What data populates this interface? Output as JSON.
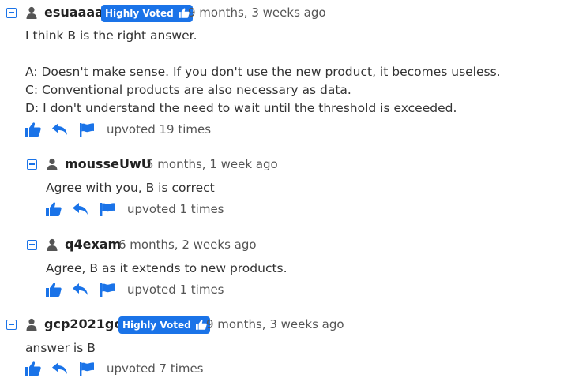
{
  "colors": {
    "accent": "#1a73e8",
    "text": "#333333",
    "muted": "#555555"
  },
  "icons": {
    "collapse": "minus-square-icon",
    "user": "user-icon",
    "badge": "thumbs-up-icon",
    "upvote": "thumbs-up-icon",
    "reply": "reply-arrow-icon",
    "report": "flag-icon"
  },
  "comments": [
    {
      "username": "esuaaaa",
      "badge": "Highly Voted",
      "time": "9 months, 3 weeks ago",
      "lines": [
        "I think B is the right answer.",
        "",
        "A: Doesn't make sense. If you don't use the new product, it becomes useless.",
        "C: Conventional products are also necessary as data.",
        "D: I don't understand the need to wait until the threshold is exceeded."
      ],
      "upvotes": "upvoted 19 times",
      "replies": [
        {
          "username": "mousseUwU",
          "time": "5 months, 1 week ago",
          "lines": [
            "Agree with you, B is correct"
          ],
          "upvotes": "upvoted 1 times"
        },
        {
          "username": "q4exam",
          "time": "6 months, 2 weeks ago",
          "lines": [
            "Agree, B as it extends to new products."
          ],
          "upvotes": "upvoted 1 times"
        }
      ]
    },
    {
      "username": "gcp2021go",
      "badge": "Highly Voted",
      "time": "9 months, 3 weeks ago",
      "lines": [
        "answer is B"
      ],
      "upvotes": "upvoted 7 times"
    }
  ]
}
